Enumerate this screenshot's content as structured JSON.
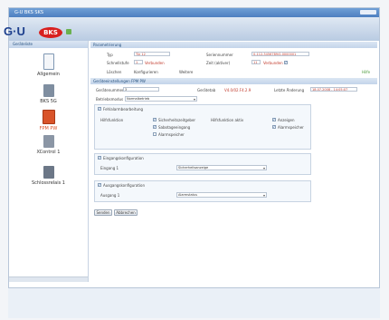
{
  "window": {
    "title": "G-U BKS SKS"
  },
  "logo": {
    "gu": "G·U",
    "bks": "BKS"
  },
  "left_pane": {
    "header": "Geräteliste",
    "items": [
      {
        "label": "Allgemein",
        "icon": "door-icon",
        "color": "#9fb6cf"
      },
      {
        "label": "BKS 5G",
        "icon": "device-icon",
        "color": "#7f8ea0"
      },
      {
        "label": "FPM PW",
        "icon": "alarm-icon",
        "color": "#d9542a"
      },
      {
        "label": "XControl 1",
        "icon": "controller-icon",
        "color": "#8b96a5"
      },
      {
        "label": "Schlossrelais 1",
        "icon": "relay-icon",
        "color": "#6c7787"
      }
    ]
  },
  "main": {
    "header": "Parametrierung",
    "name_label": "Typ",
    "name_value": "Tür 12",
    "serial_label": "Seriennummer",
    "serial_value": "0-112-3456789/0-0000001",
    "location_label": "Schnellstufe",
    "location_value": "1",
    "location_hint": "Verbunden",
    "status_label": "Zeit (aktiver)",
    "status_value": "11",
    "status_hint": "Verbunden",
    "toolbar": {
      "delete": "Löschen",
      "settings": "Konfigurieren",
      "more": "Weitere"
    },
    "help": "Hilfe",
    "sub_header": "Geräteeinstellungen FPM PW",
    "device_no_label": "Gerätenummer",
    "device_no_value": "3",
    "firmware_label": "Gerätetab",
    "firmware_value": "V4.0/02.F4.2.9",
    "last_change_label": "Letzte Änderung",
    "last_change_value": "18.07.2008 - 14:05:07",
    "mode_label": "Betriebsmodus",
    "mode_value": "Normalbetrieb",
    "group1": {
      "title": "Fehlalarmbearbeitung",
      "left_label": "Hilfsfunktion",
      "left_options": [
        "Sicherheitszeitgeber",
        "Sabotageeingang",
        "Alarmspeicher"
      ],
      "mid_label": "Hilfsfunktion aktiv",
      "right_options": [
        "Anzeigen",
        "Alarmspeicher"
      ]
    },
    "group2": {
      "title": "Eingangskonfiguration",
      "field_label": "Eingang 1",
      "field_value": "Sicherheitsanzeige"
    },
    "group3": {
      "title": "Ausgangskonfiguration",
      "field_label": "Ausgang 1",
      "field_value": "Alarmstatus"
    },
    "apply": "Senden",
    "cancel": "Abbrechen"
  }
}
